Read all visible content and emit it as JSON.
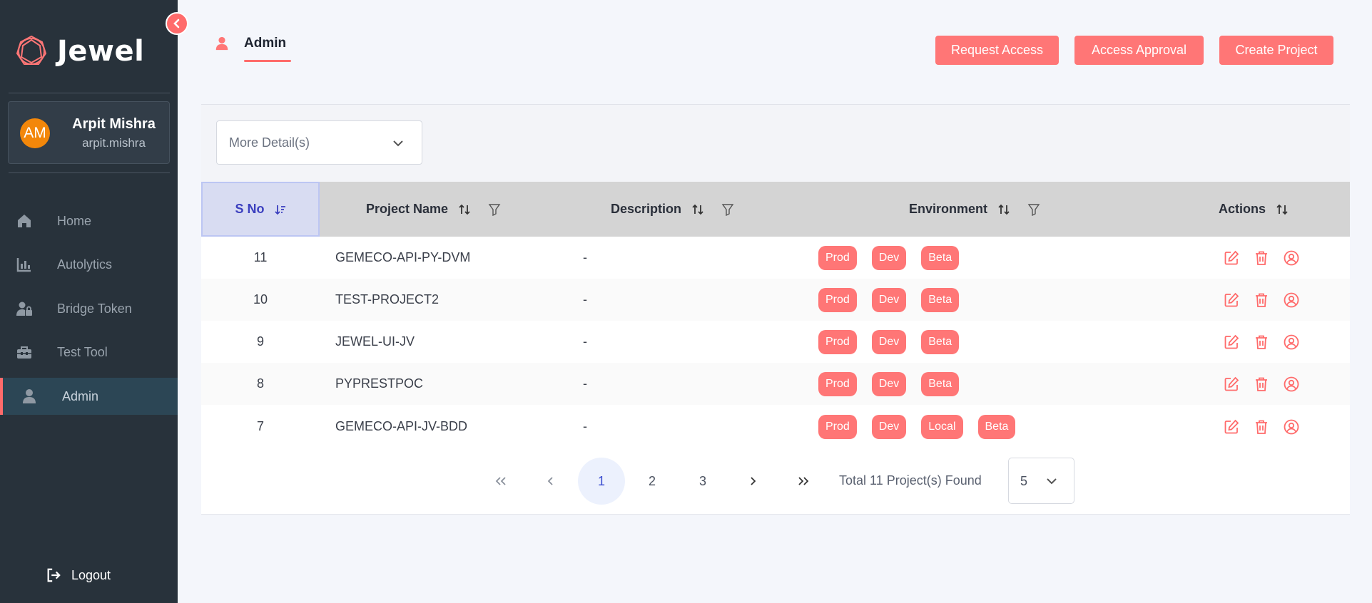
{
  "app": {
    "name": "Jewel"
  },
  "user": {
    "initials": "AM",
    "name": "Arpit Mishra",
    "handle": "arpit.mishra"
  },
  "nav": [
    {
      "label": "Home",
      "icon": "home-icon"
    },
    {
      "label": "Autolytics",
      "icon": "chart-icon"
    },
    {
      "label": "Bridge Token",
      "icon": "user-lock-icon"
    },
    {
      "label": "Test Tool",
      "icon": "toolbox-icon"
    },
    {
      "label": "Admin",
      "icon": "user-icon",
      "active": true
    }
  ],
  "logout_label": "Logout",
  "header": {
    "tab_label": "Admin",
    "buttons": {
      "request_access": "Request Access",
      "access_approval": "Access Approval",
      "create_project": "Create Project"
    }
  },
  "filter": {
    "more_details": "More Detail(s)"
  },
  "table": {
    "columns": {
      "sno": "S No",
      "project_name": "Project Name",
      "description": "Description",
      "environment": "Environment",
      "actions": "Actions"
    },
    "rows": [
      {
        "sno": "11",
        "name": "GEMECO-API-PY-DVM",
        "description": "-",
        "envs": [
          "Prod",
          "Dev",
          "Beta"
        ]
      },
      {
        "sno": "10",
        "name": "TEST-PROJECT2",
        "description": "-",
        "envs": [
          "Prod",
          "Dev",
          "Beta"
        ]
      },
      {
        "sno": "9",
        "name": "JEWEL-UI-JV",
        "description": "-",
        "envs": [
          "Prod",
          "Dev",
          "Beta"
        ]
      },
      {
        "sno": "8",
        "name": "PYPRESTPOC",
        "description": "-",
        "envs": [
          "Prod",
          "Dev",
          "Beta"
        ]
      },
      {
        "sno": "7",
        "name": "GEMECO-API-JV-BDD",
        "description": "-",
        "envs": [
          "Prod",
          "Dev",
          "Local",
          "Beta"
        ]
      }
    ]
  },
  "pagination": {
    "first": "«",
    "prev": "‹",
    "next": "›",
    "last": "»",
    "pages": [
      "1",
      "2",
      "3"
    ],
    "current": "1",
    "total_text": "Total 11 Project(s) Found",
    "page_size": "5"
  },
  "colors": {
    "accent": "#ff7676",
    "sidebar": "#28323b",
    "avatar": "#f3870a"
  }
}
